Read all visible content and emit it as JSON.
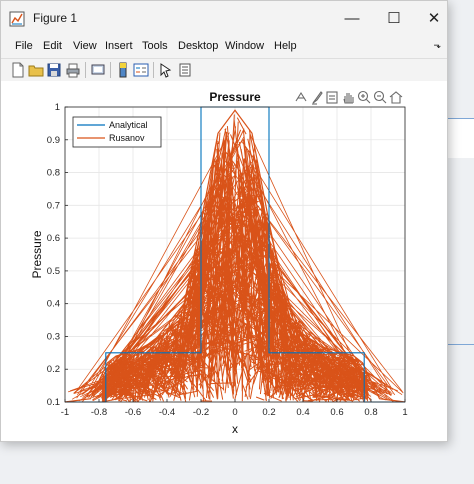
{
  "window": {
    "title": "Figure 1"
  },
  "controls": {
    "minimize": "—",
    "maximize": "☐",
    "close": "✕"
  },
  "menu": [
    "File",
    "Edit",
    "View",
    "Insert",
    "Tools",
    "Desktop",
    "Window",
    "Help"
  ],
  "toolbar_icons": [
    "new-figure-icon",
    "open-file-icon",
    "save-icon",
    "print-icon",
    "print-preview-icon",
    "insert-colorbar-icon",
    "insert-legend-icon",
    "edit-plot-icon",
    "property-inspector-icon"
  ],
  "axes_toolbar_icons": [
    "export-icon",
    "brush-icon",
    "data-tips-icon",
    "pan-icon",
    "zoom-in-icon",
    "zoom-out-icon",
    "home-icon"
  ],
  "colors": {
    "analytical": "#0072bd",
    "rusanov": "#d95319"
  },
  "chart_data": {
    "type": "line",
    "title": "Pressure",
    "xlabel": "x",
    "ylabel": "Pressure",
    "xlim": [
      -1,
      1
    ],
    "ylim": [
      0.1,
      1
    ],
    "xticks": [
      "-1",
      "-0.8",
      "-0.6",
      "-0.4",
      "-0.2",
      "0",
      "0.2",
      "0.4",
      "0.6",
      "0.8",
      "1"
    ],
    "yticks": [
      "0.1",
      "0.2",
      "0.3",
      "0.4",
      "0.5",
      "0.6",
      "0.7",
      "0.8",
      "0.9",
      "1"
    ],
    "grid": true,
    "legend_position": "top-left",
    "series": [
      {
        "name": "Analytical",
        "x": [
          -1,
          -0.76,
          -0.76,
          -0.2,
          -0.2,
          0.2,
          0.2,
          0.76,
          0.76,
          1
        ],
        "y": [
          0.1,
          0.1,
          0.25,
          0.25,
          1,
          1,
          0.25,
          0.25,
          0.1,
          0.1
        ]
      },
      {
        "name": "Rusanov",
        "x": [
          -1,
          -0.85,
          -0.75,
          -0.7,
          -0.5,
          -0.3,
          -0.2,
          -0.1,
          0,
          0.1,
          0.2,
          0.3,
          0.5,
          0.7,
          0.75,
          0.85,
          1
        ],
        "y": [
          0.1,
          0.11,
          0.22,
          0.24,
          0.27,
          0.4,
          0.65,
          0.92,
          0.99,
          0.92,
          0.65,
          0.4,
          0.27,
          0.24,
          0.22,
          0.11,
          0.1
        ]
      }
    ]
  }
}
